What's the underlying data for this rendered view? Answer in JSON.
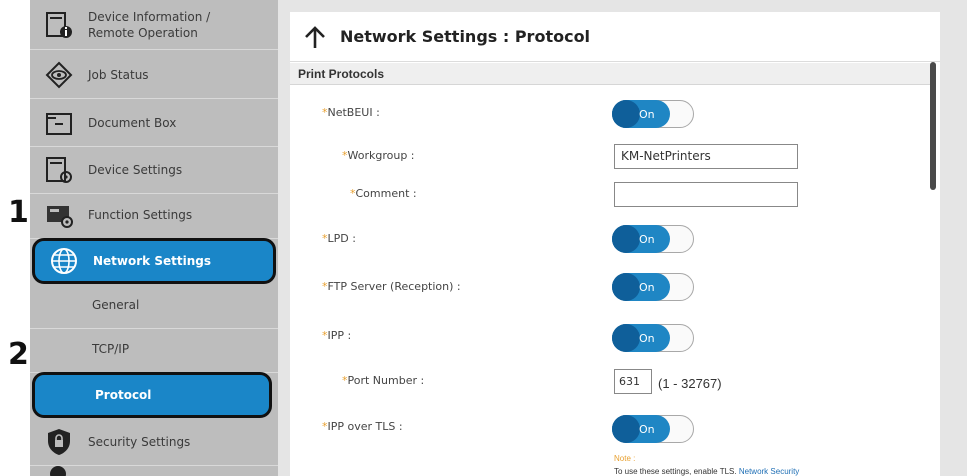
{
  "callouts": {
    "first": "1",
    "second": "2"
  },
  "sidebar": {
    "items": [
      {
        "label_line1": "Device Information /",
        "label_line2": "Remote Operation",
        "icon": "device-information-icon"
      },
      {
        "label": "Job Status",
        "icon": "eye-icon"
      },
      {
        "label": "Document Box",
        "icon": "folder-icon"
      },
      {
        "label": "Device Settings",
        "icon": "device-settings-icon"
      },
      {
        "label": "Function Settings",
        "icon": "function-settings-icon"
      },
      {
        "label": "Network Settings",
        "icon": "globe-icon",
        "active": true
      },
      {
        "label": "General"
      },
      {
        "label": "TCP/IP"
      },
      {
        "label": "Protocol",
        "active": true
      },
      {
        "label": "Security Settings",
        "icon": "shield-lock-icon"
      }
    ]
  },
  "header": {
    "title": "Network Settings : Protocol",
    "back_icon": "up-arrow-icon"
  },
  "section": {
    "title": "Print Protocols"
  },
  "settings": {
    "netbeui": {
      "label": "NetBEUI :",
      "value": "On"
    },
    "workgroup": {
      "label": "Workgroup :",
      "value": "KM-NetPrinters"
    },
    "comment": {
      "label": "Comment :",
      "value": ""
    },
    "lpd": {
      "label": "LPD :",
      "value": "On"
    },
    "ftp": {
      "label": "FTP Server (Reception) :",
      "value": "On"
    },
    "ipp": {
      "label": "IPP :",
      "value": "On"
    },
    "port": {
      "label": "Port Number :",
      "value": "631",
      "range": "(1 - 32767)"
    },
    "ipp_tls": {
      "label": "IPP over TLS :",
      "value": "On"
    }
  },
  "note": {
    "label": "Note :",
    "text": "To use these settings, enable TLS.",
    "link": "Network Security"
  },
  "star": "*",
  "colors": {
    "accent": "#1a86c8",
    "sidebar": "#bdbdbd",
    "required": "#e8a030"
  }
}
